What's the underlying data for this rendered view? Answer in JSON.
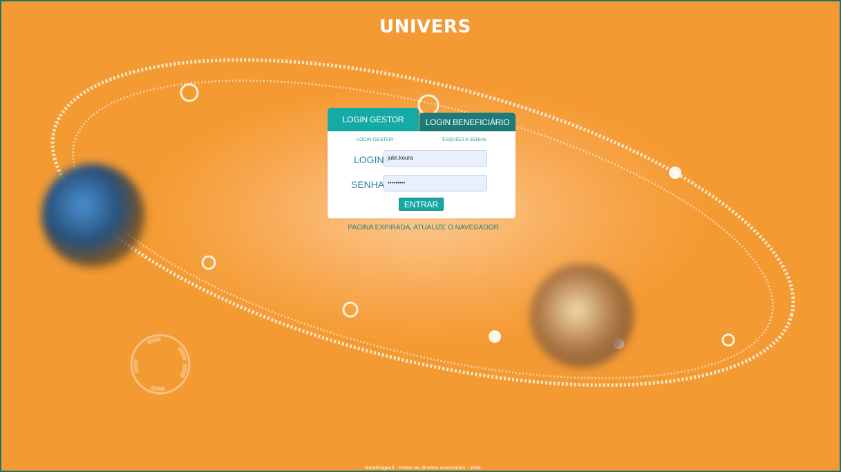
{
  "brand": {
    "logo_text": "UNIVERS"
  },
  "tabs": {
    "gestor": "LOGIN GESTOR",
    "beneficiario": "LOGIN BENEFICIÁRIO"
  },
  "links": {
    "login_gestor": "LOGIN GESTOR",
    "forgot_password": "ESQUECI A SENHA"
  },
  "form": {
    "login_label": "LOGIN",
    "login_value": "julie.koura",
    "password_label": "SENHA",
    "password_value": "•••••••••",
    "submit_label": "ENTRAR"
  },
  "status": {
    "expired_message": "PAGINA EXPIRADA, ATUALIZE O NAVEGADOR."
  },
  "footer": {
    "copyright": "Raiadrogasil - Todos os direitos reservados - 2016"
  },
  "colors": {
    "background": "#f59a32",
    "accent": "#15aaa6",
    "accent_dark": "#1c7a78",
    "annotation": "#e32222"
  }
}
